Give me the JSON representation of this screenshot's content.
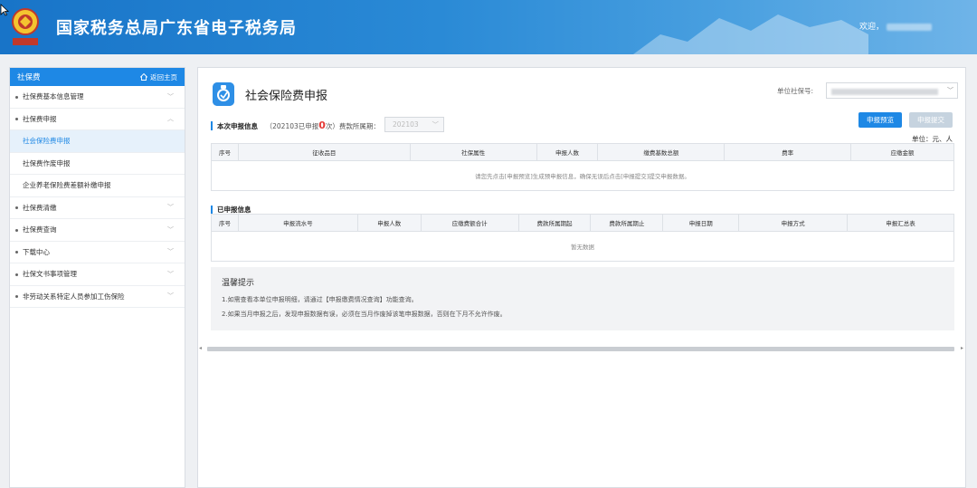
{
  "header": {
    "site_title": "国家税务总局广东省电子税务局",
    "welcome": "欢迎，"
  },
  "sidebar": {
    "title": "社保费",
    "home_link": "返回主页",
    "items": [
      {
        "label": "社保费基本信息管理",
        "expanded": false
      },
      {
        "label": "社保费申报",
        "expanded": true,
        "children": [
          "社会保险费申报",
          "社保费作废申报",
          "企业养老保险费差额补缴申报"
        ]
      },
      {
        "label": "社保费清缴",
        "expanded": false
      },
      {
        "label": "社保费查询",
        "expanded": false
      },
      {
        "label": "下载中心",
        "expanded": false
      },
      {
        "label": "社保文书事项管理",
        "expanded": false
      },
      {
        "label": "非劳动关系特定人员参加工伤保险",
        "expanded": false
      }
    ],
    "active_child": "社会保险费申报"
  },
  "main": {
    "title": "社会保险费申报",
    "unit_label": "单位社保号:",
    "section1": {
      "title": "本次申报信息",
      "period_prefix": "（202103已申报",
      "count": "0",
      "period_suffix": "次）费款所属期：",
      "period_value": "202103"
    },
    "buttons": {
      "preview": "申报预览",
      "submit": "申报提交"
    },
    "unit_note": "单位：元、人",
    "table1": {
      "headers": [
        "序号",
        "征收品目",
        "社保属性",
        "申报人数",
        "缴费基数总额",
        "费率",
        "应缴金额"
      ],
      "empty": "请您先点击[申报预览]生成预申报信息，确保无误后点击[申报提交]提交申报数据。"
    },
    "section2": {
      "title": "已申报信息"
    },
    "table2": {
      "headers": [
        "序号",
        "申报流水号",
        "申报人数",
        "应缴费额合计",
        "费款所属期起",
        "费款所属期止",
        "申报日期",
        "申报方式",
        "申报汇总表"
      ],
      "empty": "暂无数据"
    },
    "tips": {
      "title": "温馨提示",
      "lines": [
        "1.如需查看本单位申报明细，请通过【申报缴费情况查询】功能查询。",
        "2.如果当月申报之后，发现申报数据有误，必须在当月作废掉该笔申报数据，否则在下月不允许作废。"
      ]
    }
  }
}
